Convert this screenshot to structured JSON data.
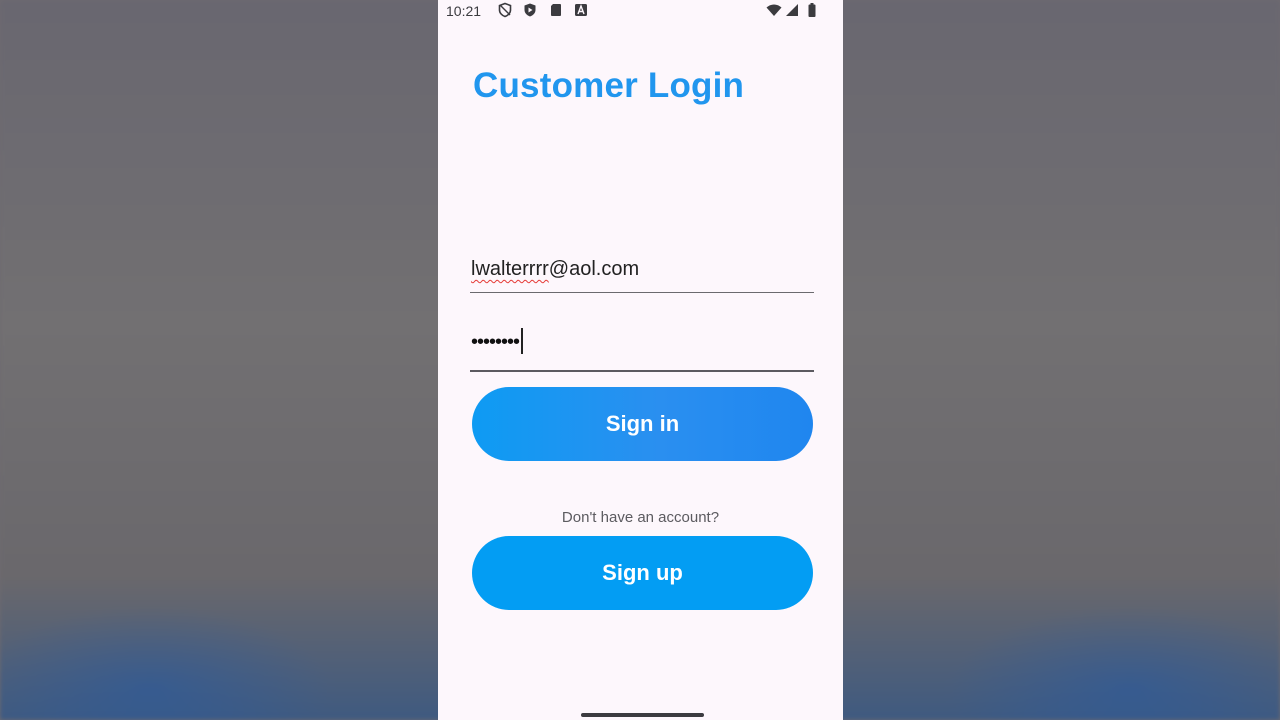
{
  "status_bar": {
    "time": "10:21",
    "left_icons": [
      "shield-outline-icon",
      "shield-play-icon",
      "sd-card-icon",
      "font-a-icon"
    ],
    "right_icons": [
      "wifi-icon",
      "signal-icon",
      "battery-icon"
    ]
  },
  "login": {
    "title": "Customer Login",
    "email_value_misspelled": "lwalterrrr",
    "email_value_rest": "@aol.com",
    "password_mask": "••••••••",
    "signin_label": "Sign in",
    "no_account_text": "Don't have an account?",
    "signup_label": "Sign up"
  },
  "colors": {
    "accent": "#2196ee",
    "button": "#039df3",
    "phone_background": "#fdf7fc"
  }
}
